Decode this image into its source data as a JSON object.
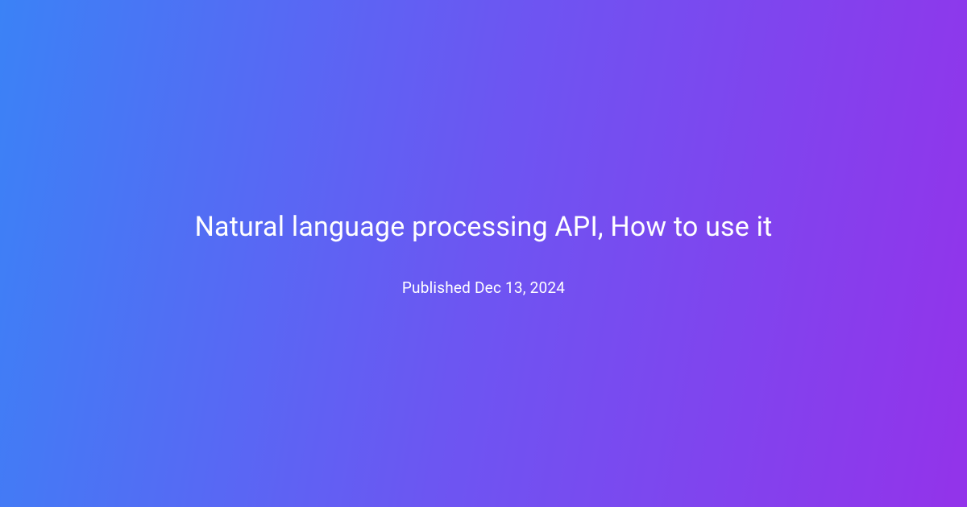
{
  "card": {
    "title": "Natural language processing API, How to use it",
    "published": "Published Dec 13, 2024"
  }
}
